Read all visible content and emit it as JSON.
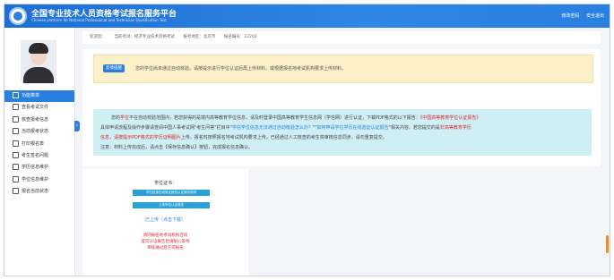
{
  "header": {
    "brand_cn": "全国专业技术人员资格考试报名服务平台",
    "brand_en": "Chinese platform for National Professional and Technician Qualification Test",
    "right_links": [
      "修改密码",
      "安全退出"
    ]
  },
  "sidebar": {
    "items": [
      {
        "label": "功能菜单"
      },
      {
        "label": "查看考试文件"
      },
      {
        "label": "核查报考信息"
      },
      {
        "label": "当前报考状态"
      },
      {
        "label": "打印报名表"
      },
      {
        "label": "考生签名问题"
      },
      {
        "label": "学历信息维护"
      },
      {
        "label": "学位信息维护"
      },
      {
        "label": "报名当前状态"
      }
    ]
  },
  "info_bar": {
    "welcome": "欢迎您：",
    "current_exam": "当前考试：经济专业技术资格考试",
    "exam_area": "报考地区：北京市",
    "exam_no": "报名编号：22202"
  },
  "yellow_notice": {
    "tag": "友情提醒",
    "text": "您的学位尚未通过自动核验，请按提示进行学位认证后再上传材料，或根据报名地考试机构要求上传材料。"
  },
  "blue_notice": {
    "line1a": "您的",
    "line1b": "学位",
    "line1c": "不在自动校验范围内，若您获得的是境内高等教育学位信息，请及时登录中国高等教育学生信息网（学信网）进行认证，下载PDF格式的以下报告：",
    "line1d": "《中国高等教育学位认证报告》",
    "line2a": "具体申请流程及操作步骤请查阅中国人事考试网\"考生问答\"栏目中\"",
    "line2b": "学信学位信息无法通过自动核验怎么办？",
    "line2c": "\"\"",
    "line2d": "如何申请学位学历在线验证认证报告",
    "line2e": "\"相关内容。若您提交的是",
    "line2f": "非高等教育学历",
    "line3a": "信息，请按提示PDF格式的学历证明图片",
    "line3b": "上传，报名时按照报名地考试机构要求上传，已经通过人工核查的考生将审核信息同步，请勿重复提交。",
    "line4": "注意：材料上传完成后，请点击【保存信息确认】按钮，完成报名信息确认。"
  },
  "certificate": {
    "title": "学位证书：",
    "btn1": "学位信息在线验证报告认证操作说明",
    "btn2": "上传学位认证报告",
    "link": "已上传（点击下载）",
    "red_lines": [
      "请向报名地考试机构咨询",
      "提交认证报告后请耐心等待",
      "审核通过后方可报名"
    ]
  },
  "colors": {
    "accent": "#2a7fe0",
    "notice_yellow": "#fcf0c8",
    "notice_blue": "#cfeff4",
    "alert_red": "#d8262b"
  }
}
